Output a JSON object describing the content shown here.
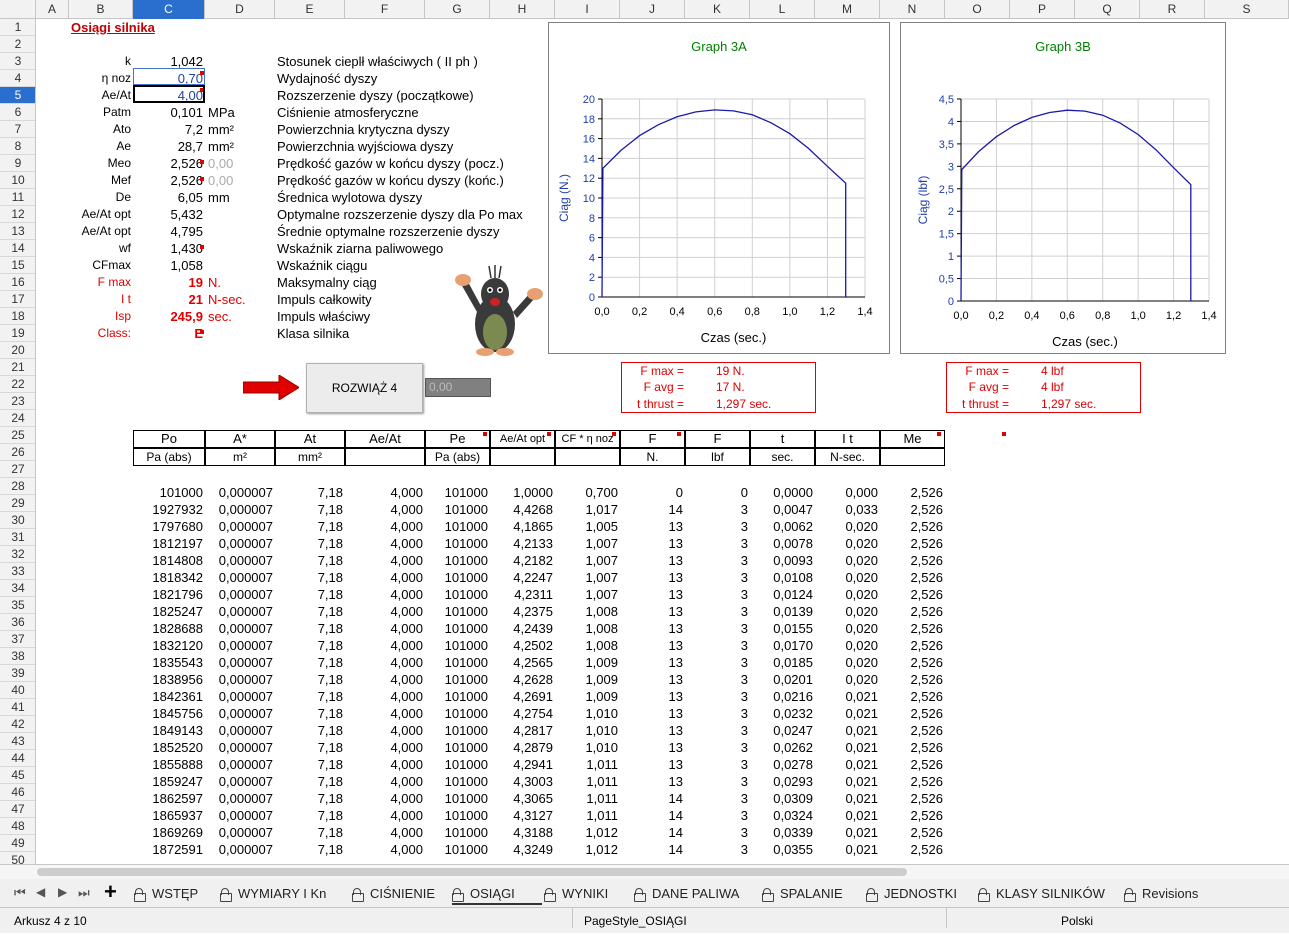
{
  "columns": [
    "",
    "A",
    "B",
    "C",
    "D",
    "E",
    "F",
    "G",
    "H",
    "I",
    "J",
    "K",
    "L",
    "M",
    "N",
    "O",
    "P",
    "Q",
    "R",
    "S"
  ],
  "selected_col": "C",
  "selected_row": "5",
  "rows_visible": [
    "1",
    "2",
    "3",
    "4",
    "5",
    "6",
    "7",
    "8",
    "9",
    "10",
    "11",
    "12",
    "13",
    "14",
    "15",
    "16",
    "17",
    "18",
    "19",
    "20",
    "21",
    "22",
    "23",
    "24",
    "25",
    "26",
    "27",
    "28",
    "29",
    "30",
    "31",
    "32",
    "33",
    "34",
    "35",
    "36",
    "37",
    "38",
    "39",
    "40",
    "41",
    "42",
    "43",
    "44",
    "45",
    "46",
    "47",
    "48",
    "49",
    "50"
  ],
  "title": "Osiągi silnika",
  "params": [
    {
      "sym": "k",
      "val": "1,042",
      "unit": "",
      "desc": "Stosunek cieplł właściwych ( II ph )"
    },
    {
      "sym": "η noz",
      "val": "0,70",
      "unit": "",
      "desc": "Wydajność dyszy"
    },
    {
      "sym": "Ae/At",
      "val": "4,00",
      "unit": "",
      "desc": "Rozszerzenie dyszy (początkowe)"
    },
    {
      "sym": "Patm",
      "val": "0,101",
      "unit": "MPa",
      "desc": "Ciśnienie atmosferyczne"
    },
    {
      "sym": "Ato",
      "val": "7,2",
      "unit": "mm²",
      "desc": "Powierzchnia krytyczna dyszy"
    },
    {
      "sym": "Ae",
      "val": "28,7",
      "unit": "mm²",
      "desc": "Powierzchnia wyjściowa dyszy"
    },
    {
      "sym": "Meo",
      "val": "2,526",
      "unit": "0,00",
      "desc": "Prędkość gazów w końcu dyszy (pocz.)"
    },
    {
      "sym": "Mef",
      "val": "2,526",
      "unit": "0,00",
      "desc": "Prędkość gazów w końcu dyszy (końc.)"
    },
    {
      "sym": "De",
      "val": "6,05",
      "unit": "mm",
      "desc": "Średnica wylotowa dyszy"
    },
    {
      "sym": "Ae/At opt",
      "val": "5,432",
      "unit": "",
      "desc": "Optymalne rozszerzenie dyszy dla Po max"
    },
    {
      "sym": "Ae/At opt",
      "val": "4,795",
      "unit": "",
      "desc": "Średnie optymalne rozszerzenie dyszy"
    },
    {
      "sym": "wf",
      "val": "1,430",
      "unit": "",
      "desc": "Wskaźnik ziarna paliwowego"
    },
    {
      "sym": "CFmax",
      "val": "1,058",
      "unit": "",
      "desc": "Wskaźnik ciągu"
    },
    {
      "sym": "F max",
      "val": "19",
      "unit": "N.",
      "desc": "Maksymalny ciąg"
    },
    {
      "sym": "I t",
      "val": "21",
      "unit": "N-sec.",
      "desc": "Impuls całkowity"
    },
    {
      "sym": "Isp",
      "val": "245,9",
      "unit": "sec.",
      "desc": "Impuls właściwy"
    },
    {
      "sym": "Class:",
      "val": "E",
      "unit": "",
      "desc": "Klasa silnika"
    }
  ],
  "solve_button": "ROZWIĄŻ 4",
  "solve_value": "0,00",
  "graph_a": {
    "title": "Graph 3A",
    "ylabel": "Ciąg (N.)",
    "xlabel": "Czas  (sec.)",
    "yticks": [
      "20",
      "18",
      "16",
      "14",
      "12",
      "10",
      "8",
      "6",
      "4",
      "2",
      "0"
    ],
    "xticks": [
      "0,0",
      "0,2",
      "0,4",
      "0,6",
      "0,8",
      "1,0",
      "1,2",
      "1,4"
    ]
  },
  "graph_b": {
    "title": "Graph 3B",
    "ylabel": "Ciąg  (lbf)",
    "xlabel": "Czas (sec.)",
    "yticks": [
      "4,5",
      "4",
      "3,5",
      "3",
      "2,5",
      "2",
      "1,5",
      "1",
      "0,5",
      "0"
    ],
    "xticks": [
      "0,0",
      "0,2",
      "0,4",
      "0,6",
      "0,8",
      "1,0",
      "1,2",
      "1,4"
    ]
  },
  "chart_data": [
    {
      "type": "line",
      "title": "Graph 3A",
      "xlabel": "Czas  (sec.)",
      "ylabel": "Ciąg (N.)",
      "xlim": [
        0,
        1.4
      ],
      "ylim": [
        0,
        20
      ],
      "x": [
        0,
        0.0047,
        0.1,
        0.2,
        0.3,
        0.4,
        0.5,
        0.6,
        0.7,
        0.8,
        0.9,
        1.0,
        1.1,
        1.2,
        1.297,
        1.297,
        1.31
      ],
      "y": [
        0,
        13,
        14.8,
        16.3,
        17.4,
        18.2,
        18.7,
        18.9,
        18.8,
        18.4,
        17.6,
        16.5,
        15,
        13.2,
        11.5,
        0,
        0
      ]
    },
    {
      "type": "line",
      "title": "Graph 3B",
      "xlabel": "Czas (sec.)",
      "ylabel": "Ciąg  (lbf)",
      "xlim": [
        0,
        1.4
      ],
      "ylim": [
        0,
        4.5
      ],
      "x": [
        0,
        0.0047,
        0.1,
        0.2,
        0.3,
        0.4,
        0.5,
        0.6,
        0.7,
        0.8,
        0.9,
        1.0,
        1.1,
        1.2,
        1.297,
        1.297,
        1.31
      ],
      "y": [
        0,
        2.93,
        3.33,
        3.66,
        3.91,
        4.09,
        4.2,
        4.25,
        4.23,
        4.14,
        3.96,
        3.71,
        3.37,
        2.97,
        2.59,
        0,
        0
      ]
    }
  ],
  "sum_a": {
    "rows": [
      [
        "F max =",
        "19 N."
      ],
      [
        "F avg =",
        "17 N."
      ],
      [
        "t thrust =",
        "1,297 sec."
      ]
    ]
  },
  "sum_b": {
    "rows": [
      [
        "F max =",
        "4 lbf"
      ],
      [
        "F avg =",
        "4 lbf"
      ],
      [
        "t thrust =",
        "1,297 sec."
      ]
    ]
  },
  "table": {
    "headers": [
      "Po",
      "A*",
      "At",
      "Ae/At",
      "Pe",
      "Ae/At opt",
      "CF * η noz",
      "F",
      "F",
      "t",
      "I t",
      "Me"
    ],
    "units": [
      "Pa (abs)",
      "m²",
      "mm²",
      "",
      "Pa (abs)",
      "",
      "",
      "N.",
      "lbf",
      "sec.",
      "N-sec.",
      ""
    ],
    "rows": [
      [
        "101000",
        "0,000007",
        "7,18",
        "4,000",
        "101000",
        "1,0000",
        "0,700",
        "0",
        "0",
        "0,0000",
        "0,000",
        "2,526"
      ],
      [
        "1927932",
        "0,000007",
        "7,18",
        "4,000",
        "101000",
        "4,4268",
        "1,017",
        "14",
        "3",
        "0,0047",
        "0,033",
        "2,526"
      ],
      [
        "1797680",
        "0,000007",
        "7,18",
        "4,000",
        "101000",
        "4,1865",
        "1,005",
        "13",
        "3",
        "0,0062",
        "0,020",
        "2,526"
      ],
      [
        "1812197",
        "0,000007",
        "7,18",
        "4,000",
        "101000",
        "4,2133",
        "1,007",
        "13",
        "3",
        "0,0078",
        "0,020",
        "2,526"
      ],
      [
        "1814808",
        "0,000007",
        "7,18",
        "4,000",
        "101000",
        "4,2182",
        "1,007",
        "13",
        "3",
        "0,0093",
        "0,020",
        "2,526"
      ],
      [
        "1818342",
        "0,000007",
        "7,18",
        "4,000",
        "101000",
        "4,2247",
        "1,007",
        "13",
        "3",
        "0,0108",
        "0,020",
        "2,526"
      ],
      [
        "1821796",
        "0,000007",
        "7,18",
        "4,000",
        "101000",
        "4,2311",
        "1,007",
        "13",
        "3",
        "0,0124",
        "0,020",
        "2,526"
      ],
      [
        "1825247",
        "0,000007",
        "7,18",
        "4,000",
        "101000",
        "4,2375",
        "1,008",
        "13",
        "3",
        "0,0139",
        "0,020",
        "2,526"
      ],
      [
        "1828688",
        "0,000007",
        "7,18",
        "4,000",
        "101000",
        "4,2439",
        "1,008",
        "13",
        "3",
        "0,0155",
        "0,020",
        "2,526"
      ],
      [
        "1832120",
        "0,000007",
        "7,18",
        "4,000",
        "101000",
        "4,2502",
        "1,008",
        "13",
        "3",
        "0,0170",
        "0,020",
        "2,526"
      ],
      [
        "1835543",
        "0,000007",
        "7,18",
        "4,000",
        "101000",
        "4,2565",
        "1,009",
        "13",
        "3",
        "0,0185",
        "0,020",
        "2,526"
      ],
      [
        "1838956",
        "0,000007",
        "7,18",
        "4,000",
        "101000",
        "4,2628",
        "1,009",
        "13",
        "3",
        "0,0201",
        "0,020",
        "2,526"
      ],
      [
        "1842361",
        "0,000007",
        "7,18",
        "4,000",
        "101000",
        "4,2691",
        "1,009",
        "13",
        "3",
        "0,0216",
        "0,021",
        "2,526"
      ],
      [
        "1845756",
        "0,000007",
        "7,18",
        "4,000",
        "101000",
        "4,2754",
        "1,010",
        "13",
        "3",
        "0,0232",
        "0,021",
        "2,526"
      ],
      [
        "1849143",
        "0,000007",
        "7,18",
        "4,000",
        "101000",
        "4,2817",
        "1,010",
        "13",
        "3",
        "0,0247",
        "0,021",
        "2,526"
      ],
      [
        "1852520",
        "0,000007",
        "7,18",
        "4,000",
        "101000",
        "4,2879",
        "1,010",
        "13",
        "3",
        "0,0262",
        "0,021",
        "2,526"
      ],
      [
        "1855888",
        "0,000007",
        "7,18",
        "4,000",
        "101000",
        "4,2941",
        "1,011",
        "13",
        "3",
        "0,0278",
        "0,021",
        "2,526"
      ],
      [
        "1859247",
        "0,000007",
        "7,18",
        "4,000",
        "101000",
        "4,3003",
        "1,011",
        "13",
        "3",
        "0,0293",
        "0,021",
        "2,526"
      ],
      [
        "1862597",
        "0,000007",
        "7,18",
        "4,000",
        "101000",
        "4,3065",
        "1,011",
        "14",
        "3",
        "0,0309",
        "0,021",
        "2,526"
      ],
      [
        "1865937",
        "0,000007",
        "7,18",
        "4,000",
        "101000",
        "4,3127",
        "1,011",
        "14",
        "3",
        "0,0324",
        "0,021",
        "2,526"
      ],
      [
        "1869269",
        "0,000007",
        "7,18",
        "4,000",
        "101000",
        "4,3188",
        "1,012",
        "14",
        "3",
        "0,0339",
        "0,021",
        "2,526"
      ],
      [
        "1872591",
        "0,000007",
        "7,18",
        "4,000",
        "101000",
        "4,3249",
        "1,012",
        "14",
        "3",
        "0,0355",
        "0,021",
        "2,526"
      ]
    ]
  },
  "tabs": [
    "WSTĘP",
    "WYMIARY I Kn",
    "CIŚNIENIE",
    "OSIĄGI",
    "WYNIKI",
    "DANE PALIWA",
    "SPALANIE",
    "JEDNOSTKI",
    "KLASY SILNIKÓW",
    "Revisions"
  ],
  "active_tab": "OSIĄGI",
  "status": {
    "sheet": "Arkusz 4 z 10",
    "page_style": "PageStyle_OSIĄGI",
    "language": "Polski"
  }
}
